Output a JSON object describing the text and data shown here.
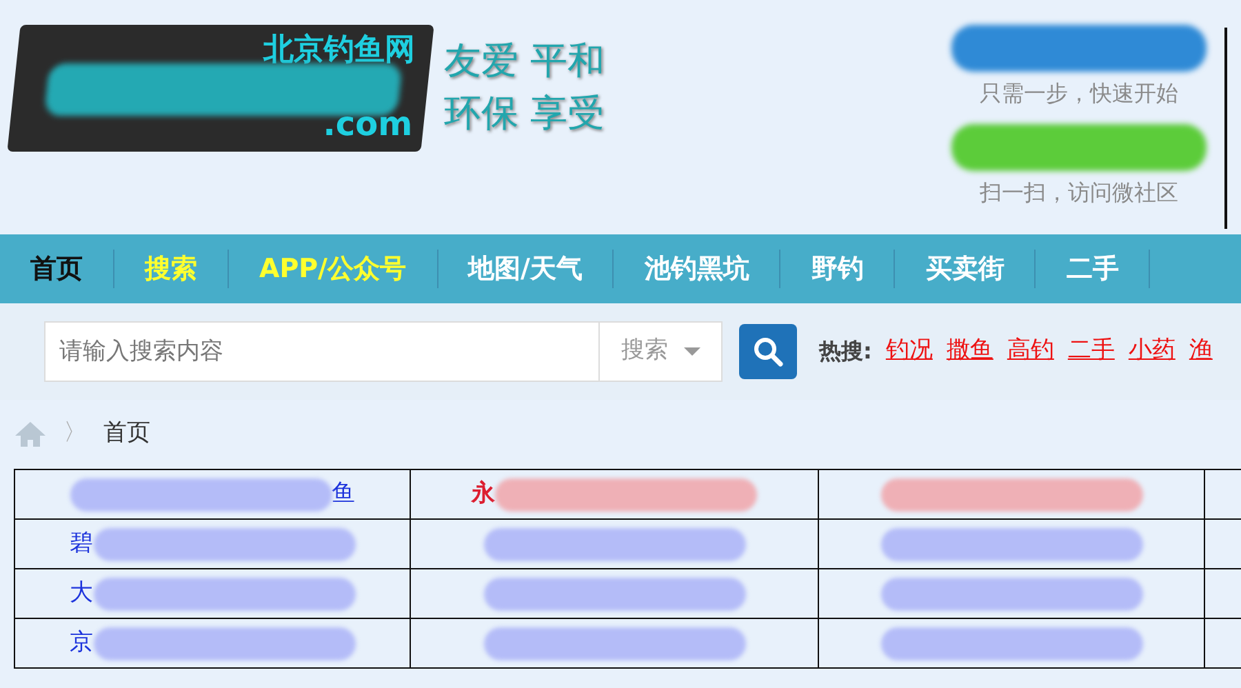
{
  "logo": {
    "site_name": "北京钓鱼网",
    "domain": ".com"
  },
  "slogan": [
    "友爱 平和",
    "环保 享受"
  ],
  "account": [
    {
      "kind": "blue",
      "caption": "只需一步，快速开始"
    },
    {
      "kind": "green",
      "caption": "扫一扫，访问微社区"
    }
  ],
  "nav": [
    {
      "label": "首页",
      "selected": true,
      "highlight": false
    },
    {
      "label": "搜索",
      "selected": false,
      "highlight": true
    },
    {
      "label": "APP/公众号",
      "selected": false,
      "highlight": true
    },
    {
      "label": "地图/天气",
      "selected": false,
      "highlight": false
    },
    {
      "label": "池钓黑坑",
      "selected": false,
      "highlight": false
    },
    {
      "label": "野钓",
      "selected": false,
      "highlight": false
    },
    {
      "label": "买卖街",
      "selected": false,
      "highlight": false
    },
    {
      "label": "二手",
      "selected": false,
      "highlight": false
    }
  ],
  "search": {
    "placeholder": "请输入搜索内容",
    "scope": "搜索"
  },
  "hot_search": {
    "label": "热搜:",
    "terms": [
      "钓况",
      "撒鱼",
      "高钓",
      "二手",
      "小药",
      "渔"
    ]
  },
  "breadcrumb": {
    "separator": "〉",
    "current": "首页"
  },
  "table": {
    "rows": [
      [
        {
          "text_end": "鱼",
          "color": "#b4bcf8"
        },
        {
          "text_start": "永",
          "color": "#efb0b6"
        },
        {
          "color": "#efb0b6"
        }
      ],
      [
        {
          "text_start": "碧",
          "color": "#b4bcf8"
        },
        {
          "color": "#b4bcf8"
        },
        {
          "color": "#b4bcf8"
        }
      ],
      [
        {
          "text_start": "大",
          "color": "#b4bcf8"
        },
        {
          "color": "#b4bcf8"
        },
        {
          "color": "#b4bcf8"
        }
      ],
      [
        {
          "text_start": "京",
          "color": "#b4bcf8"
        },
        {
          "color": "#b4bcf8"
        },
        {
          "color": "#b4bcf8"
        }
      ]
    ]
  }
}
